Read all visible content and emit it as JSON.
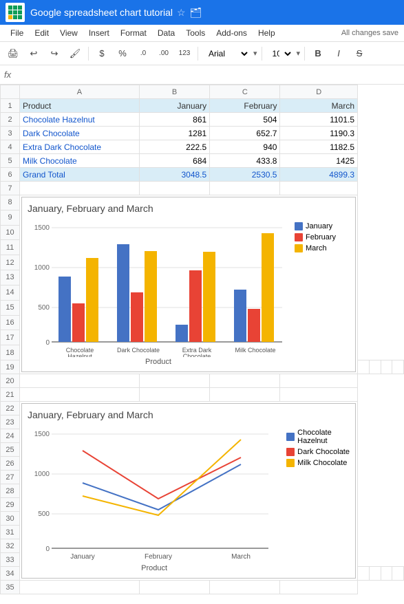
{
  "app": {
    "title": "Google spreadsheet chart tutorial",
    "save_status": "All changes save"
  },
  "menu": {
    "items": [
      "File",
      "Edit",
      "View",
      "Insert",
      "Format",
      "Data",
      "Tools",
      "Add-ons",
      "Help"
    ]
  },
  "toolbar": {
    "font": "Arial",
    "font_size": "10"
  },
  "spreadsheet": {
    "columns": [
      "",
      "A",
      "B",
      "C",
      "D"
    ],
    "col_labels": [
      "",
      "Product",
      "January",
      "February",
      "March"
    ],
    "rows": [
      {
        "num": "1",
        "a": "Product",
        "b": "January",
        "c": "February",
        "d": "March",
        "header": true
      },
      {
        "num": "2",
        "a": "Chocolate Hazelnut",
        "b": "861",
        "c": "504",
        "d": "1101.5"
      },
      {
        "num": "3",
        "a": "Dark Chocolate",
        "b": "1281",
        "c": "652.7",
        "d": "1190.3"
      },
      {
        "num": "4",
        "a": "Extra Dark Chocolate",
        "b": "222.5",
        "c": "940",
        "d": "1182.5"
      },
      {
        "num": "5",
        "a": "Milk Chocolate",
        "b": "684",
        "c": "433.8",
        "d": "1425"
      },
      {
        "num": "6",
        "a": "Grand Total",
        "b": "3048.5",
        "c": "2530.5",
        "d": "4899.3",
        "grand": true
      }
    ],
    "empty_rows": [
      "7",
      "8",
      "19",
      "20",
      "21",
      "22",
      "23",
      "29",
      "30",
      "31",
      "32",
      "34"
    ]
  },
  "chart1": {
    "title": "January, February and March",
    "x_label": "Product",
    "y_max": 1500,
    "y_ticks": [
      0,
      500,
      1000,
      1500
    ],
    "legend": [
      {
        "label": "January",
        "color": "#4472c4"
      },
      {
        "label": "February",
        "color": "#e84335"
      },
      {
        "label": "March",
        "color": "#f4b400"
      }
    ],
    "categories": [
      "Chocolate\nHazelnut",
      "Dark Chocolate",
      "Extra Dark\nChocolate",
      "Milk Chocolate"
    ],
    "series": {
      "january": [
        861,
        1281,
        222.5,
        684
      ],
      "february": [
        504,
        652.7,
        940,
        433.8
      ],
      "march": [
        1101.5,
        1190.3,
        1182.5,
        1425
      ]
    }
  },
  "chart2": {
    "title": "January, February and March",
    "x_label": "Product",
    "y_max": 1500,
    "legend": [
      {
        "label": "Chocolate Hazelnut",
        "color": "#4472c4"
      },
      {
        "label": "Dark Chocolate",
        "color": "#e84335"
      },
      {
        "label": "Milk Chocolate",
        "color": "#f4b400"
      }
    ],
    "x_labels": [
      "January",
      "February",
      "March"
    ],
    "series": {
      "chocolate_hazelnut": [
        861,
        504,
        1101.5
      ],
      "dark_chocolate": [
        1281,
        652.7,
        1190.3
      ],
      "milk_chocolate": [
        684,
        433.8,
        1425
      ]
    }
  }
}
